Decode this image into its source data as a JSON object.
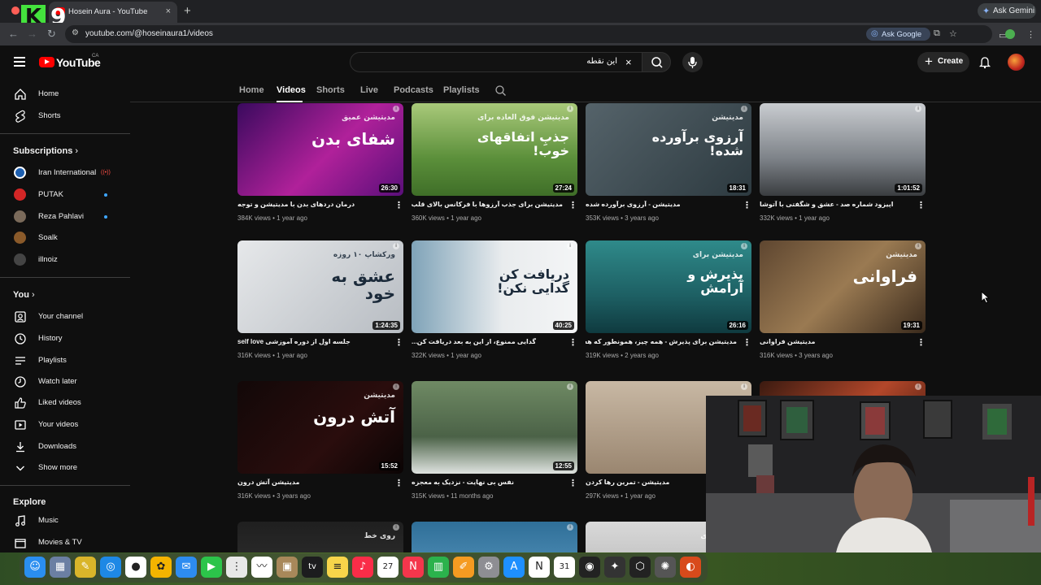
{
  "browser": {
    "tab_title": "Hosein Aura - YouTube",
    "tab_close": "×",
    "new_tab": "+",
    "url": "youtube.com/@hoseinaura1/videos",
    "ask_google": "Ask Google",
    "ask_gemini": "Ask Gemini"
  },
  "overlay_logo": {
    "letter": "K",
    "digit": "9"
  },
  "masthead": {
    "logo_text": "YouTube",
    "country": "CA",
    "search_value": "این نقطه",
    "clear_icon": "×",
    "create_label": "Create",
    "create_plus": "+"
  },
  "sidebar": {
    "main": [
      {
        "label": "Home",
        "icon": "home-icon"
      },
      {
        "label": "Shorts",
        "icon": "shorts-icon"
      }
    ],
    "subscriptions_heading": "Subscriptions",
    "subscriptions": [
      {
        "label": "Iran International",
        "avatar_color": "#1d5fb0",
        "indicator": "live"
      },
      {
        "label": "PUTAK",
        "avatar_color": "#d32626",
        "indicator": "new"
      },
      {
        "label": "Reza Pahlavi",
        "avatar_color": "#7a6a5a",
        "indicator": "new"
      },
      {
        "label": "Soalk",
        "avatar_color": "#8a5a2a",
        "indicator": ""
      },
      {
        "label": "illnoiz",
        "avatar_color": "#444444",
        "indicator": ""
      }
    ],
    "you_heading": "You",
    "you_items": [
      {
        "label": "Your channel",
        "icon": "your-channel-icon"
      },
      {
        "label": "History",
        "icon": "history-icon"
      },
      {
        "label": "Playlists",
        "icon": "playlists-icon"
      },
      {
        "label": "Watch later",
        "icon": "watch-later-icon"
      },
      {
        "label": "Liked videos",
        "icon": "liked-videos-icon"
      },
      {
        "label": "Your videos",
        "icon": "your-videos-icon"
      },
      {
        "label": "Downloads",
        "icon": "downloads-icon"
      },
      {
        "label": "Show more",
        "icon": "chevron-down-icon"
      }
    ],
    "explore_heading": "Explore",
    "explore_items": [
      {
        "label": "Music",
        "icon": "music-icon"
      },
      {
        "label": "Movies & TV",
        "icon": "movies-icon"
      }
    ]
  },
  "channel_tabs": [
    "Home",
    "Videos",
    "Shorts",
    "Live",
    "Podcasts",
    "Playlists"
  ],
  "active_tab": "Videos",
  "videos": [
    {
      "title": "درمان دردهای بدن با مدیتیشن و توجه",
      "views": "384K views",
      "age": "1 year ago",
      "duration": "26:30",
      "thumb_text": "شفای بدن",
      "thumb_sub": "مدیتیشن عمیق",
      "bg": "linear-gradient(135deg,#3a0a5e,#b0219a 55%,#5a0f7a)"
    },
    {
      "title": "مدیتیشن برای جذب آرزوها با فرکانس بالای قلب",
      "views": "360K views",
      "age": "1 year ago",
      "duration": "27:24",
      "thumb_text": "جذبِ اتفاقهای خوب!",
      "thumb_sub": "مدیتیشن فوق العاده برای",
      "bg": "linear-gradient(180deg,#a9c97a,#5b8f3a 60%,#3f6e28)"
    },
    {
      "title": "مدیتیشن - آرزوی برآورده شده",
      "views": "353K views",
      "age": "3 years ago",
      "duration": "18:31",
      "thumb_text": "آرزوی برآورده شده!",
      "thumb_sub": "مدیتیشن",
      "bg": "linear-gradient(135deg,#55636a,#2d3a40)"
    },
    {
      "title": "اپیزود شماره صد - عشق و شگفتی با آتوشا",
      "views": "332K views",
      "age": "1 year ago",
      "duration": "1:01:52",
      "thumb_text": "",
      "thumb_sub": "",
      "bg": "linear-gradient(180deg,#c9ccd0,#7d8288 60%,#3a3d40)"
    },
    {
      "title": "جلسه اول از دوره آموزشی self love",
      "views": "316K views",
      "age": "1 year ago",
      "duration": "1:24:35",
      "thumb_text": "عشق به خود",
      "thumb_sub": "ورکشاپ ۱۰ روزه",
      "bg": "linear-gradient(135deg,#e6e8ea,#b7bcc2)",
      "dark_text": true
    },
    {
      "title": "گدایی ممنوع، از این به بعد دریافت کن...",
      "views": "322K views",
      "age": "1 year ago",
      "duration": "40:25",
      "thumb_text": "دریافت کن گدایی نکن!",
      "thumb_sub": "",
      "bg": "linear-gradient(90deg,#7fa3b8,#e9ecee 55%,#f4f5f6)",
      "dark_text": true
    },
    {
      "title": "مدیتیشن برای پذیرش - همه چیز، همونطور که هست",
      "views": "319K views",
      "age": "2 years ago",
      "duration": "26:16",
      "thumb_text": "پذیرش و آرامش",
      "thumb_sub": "مدیتیشن برای",
      "bg": "linear-gradient(180deg,#2f8a8a,#1d5f63 60%,#0f3a3f)"
    },
    {
      "title": "مدیتیشن فراوانی",
      "views": "316K views",
      "age": "3 years ago",
      "duration": "19:31",
      "thumb_text": "فراوانی",
      "thumb_sub": "مدیتیشن",
      "bg": "linear-gradient(135deg,#5e4630,#9a7a52 50%,#3a2a1c)"
    },
    {
      "title": "مدیتیشن آتش درون",
      "views": "316K views",
      "age": "3 years ago",
      "duration": "15:52",
      "thumb_text": "آتش درون",
      "thumb_sub": "مدیتیشن",
      "bg": "linear-gradient(135deg,#120808,#2a0d0d 60%,#0a0404)"
    },
    {
      "title": "نفس بی نهایت - نزدیک به معجزه",
      "views": "315K views",
      "age": "11 months ago",
      "duration": "12:55",
      "thumb_text": "",
      "thumb_sub": "",
      "bg": "linear-gradient(180deg,#6f8a64,#4b6247 60%,#dfe3e0)"
    },
    {
      "title": "مدیتیشن - تمرین رها کردن",
      "views": "297K views",
      "age": "1 year ago",
      "duration": "",
      "thumb_text": "",
      "thumb_sub": "",
      "bg": "linear-gradient(180deg,#c8b8a4,#9a8670)"
    },
    {
      "title": "",
      "views": "",
      "age": "",
      "duration": "",
      "thumb_text": "",
      "thumb_sub": "",
      "bg": "linear-gradient(135deg,#3a1a10,#b3472a 50%,#2a0f08)"
    },
    {
      "title": "",
      "views": "",
      "age": "",
      "duration": "",
      "thumb_text": "",
      "thumb_sub": "روی خط",
      "bg": "linear-gradient(180deg,#1f1f1f,#3a3a3a)"
    },
    {
      "title": "",
      "views": "",
      "age": "",
      "duration": "",
      "thumb_text": "",
      "thumb_sub": "",
      "bg": "linear-gradient(180deg,#2f6f98,#6aa7cf)"
    },
    {
      "title": "",
      "views": "",
      "age": "",
      "duration": "",
      "thumb_text": "",
      "thumb_sub": "مهارت برای",
      "bg": "linear-gradient(180deg,#d9d9d9,#a8a8a8)"
    }
  ],
  "dock": [
    {
      "name": "finder-icon",
      "glyph": "☺",
      "color": "#2a8ef0"
    },
    {
      "name": "launchpad-icon",
      "glyph": "▦",
      "color": "#6b7fa3"
    },
    {
      "name": "app-icon",
      "glyph": "✎",
      "color": "#d9b52a"
    },
    {
      "name": "safari-icon",
      "glyph": "◎",
      "color": "#1e88e5"
    },
    {
      "name": "chrome-icon",
      "glyph": "●",
      "color": "#ffffff"
    },
    {
      "name": "photos-icon",
      "glyph": "✿",
      "color": "#f4b400"
    },
    {
      "name": "mail-icon",
      "glyph": "✉",
      "color": "#2d8cf0"
    },
    {
      "name": "facetime-icon",
      "glyph": "▶",
      "color": "#2cc44a"
    },
    {
      "name": "notes-app-icon",
      "glyph": "⋮",
      "color": "#e8e8e8"
    },
    {
      "name": "freeform-icon",
      "glyph": "〰",
      "color": "#ffffff"
    },
    {
      "name": "app-icon-2",
      "glyph": "▣",
      "color": "#a8885a"
    },
    {
      "name": "tv-icon",
      "glyph": "tv",
      "color": "#1c1c1e"
    },
    {
      "name": "notes-icon",
      "glyph": "≡",
      "color": "#f7d54a"
    },
    {
      "name": "music-icon",
      "glyph": "♪",
      "color": "#fa2d48"
    },
    {
      "name": "calendar-icon",
      "glyph": "27",
      "color": "#ffffff"
    },
    {
      "name": "news-icon",
      "glyph": "N",
      "color": "#f4364c"
    },
    {
      "name": "numbers-icon",
      "glyph": "▥",
      "color": "#2bb24c"
    },
    {
      "name": "pages-icon",
      "glyph": "✐",
      "color": "#f59b21"
    },
    {
      "name": "settings-icon",
      "glyph": "⚙",
      "color": "#8e8e93"
    },
    {
      "name": "app-store-icon",
      "glyph": "A",
      "color": "#1e90ff"
    },
    {
      "name": "notion-icon",
      "glyph": "N",
      "color": "#ffffff"
    },
    {
      "name": "calendar-2-icon",
      "glyph": "31",
      "color": "#ffffff"
    },
    {
      "name": "app-icon-3",
      "glyph": "◉",
      "color": "#222222"
    },
    {
      "name": "app-icon-4",
      "glyph": "✦",
      "color": "#333333"
    },
    {
      "name": "app-icon-5",
      "glyph": "⬡",
      "color": "#222222"
    },
    {
      "name": "app-icon-6",
      "glyph": "✺",
      "color": "#555555"
    },
    {
      "name": "app-icon-7",
      "glyph": "◐",
      "color": "#d84a1b"
    }
  ]
}
